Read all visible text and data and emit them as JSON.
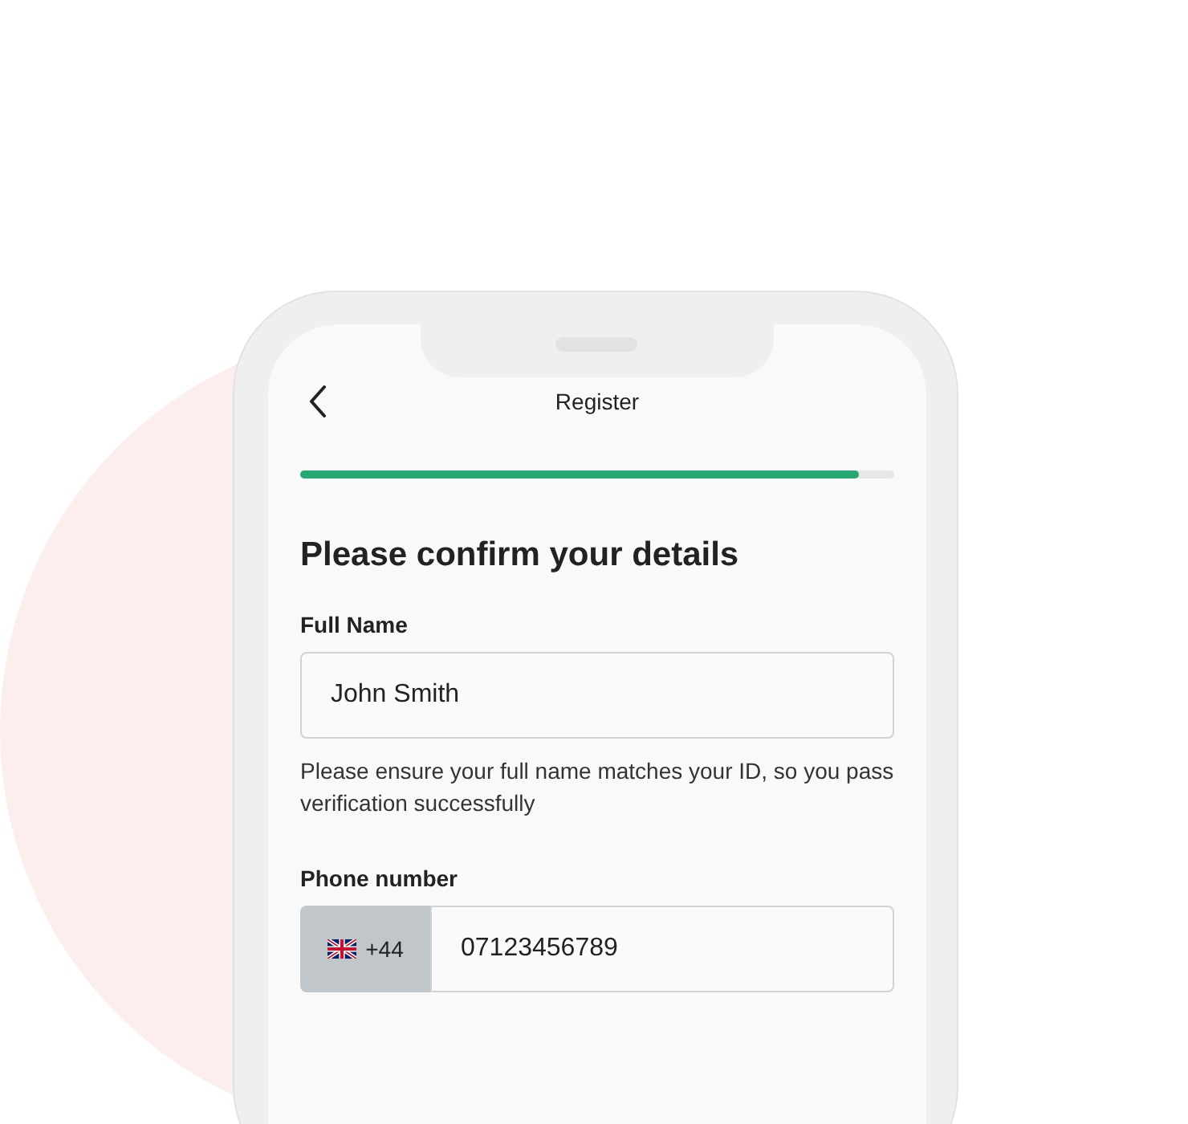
{
  "header": {
    "title": "Register"
  },
  "progress": {
    "level": 0.94
  },
  "heading": "Please confirm your details",
  "fields": [
    {
      "kind": "text",
      "label": "Full Name",
      "value": "John Smith",
      "hint": "Please ensure your full name matches your ID, so you pass verification successfully"
    },
    {
      "kind": "phone",
      "label": "Phone number",
      "prefix": "+44",
      "value": "07123456789"
    }
  ]
}
